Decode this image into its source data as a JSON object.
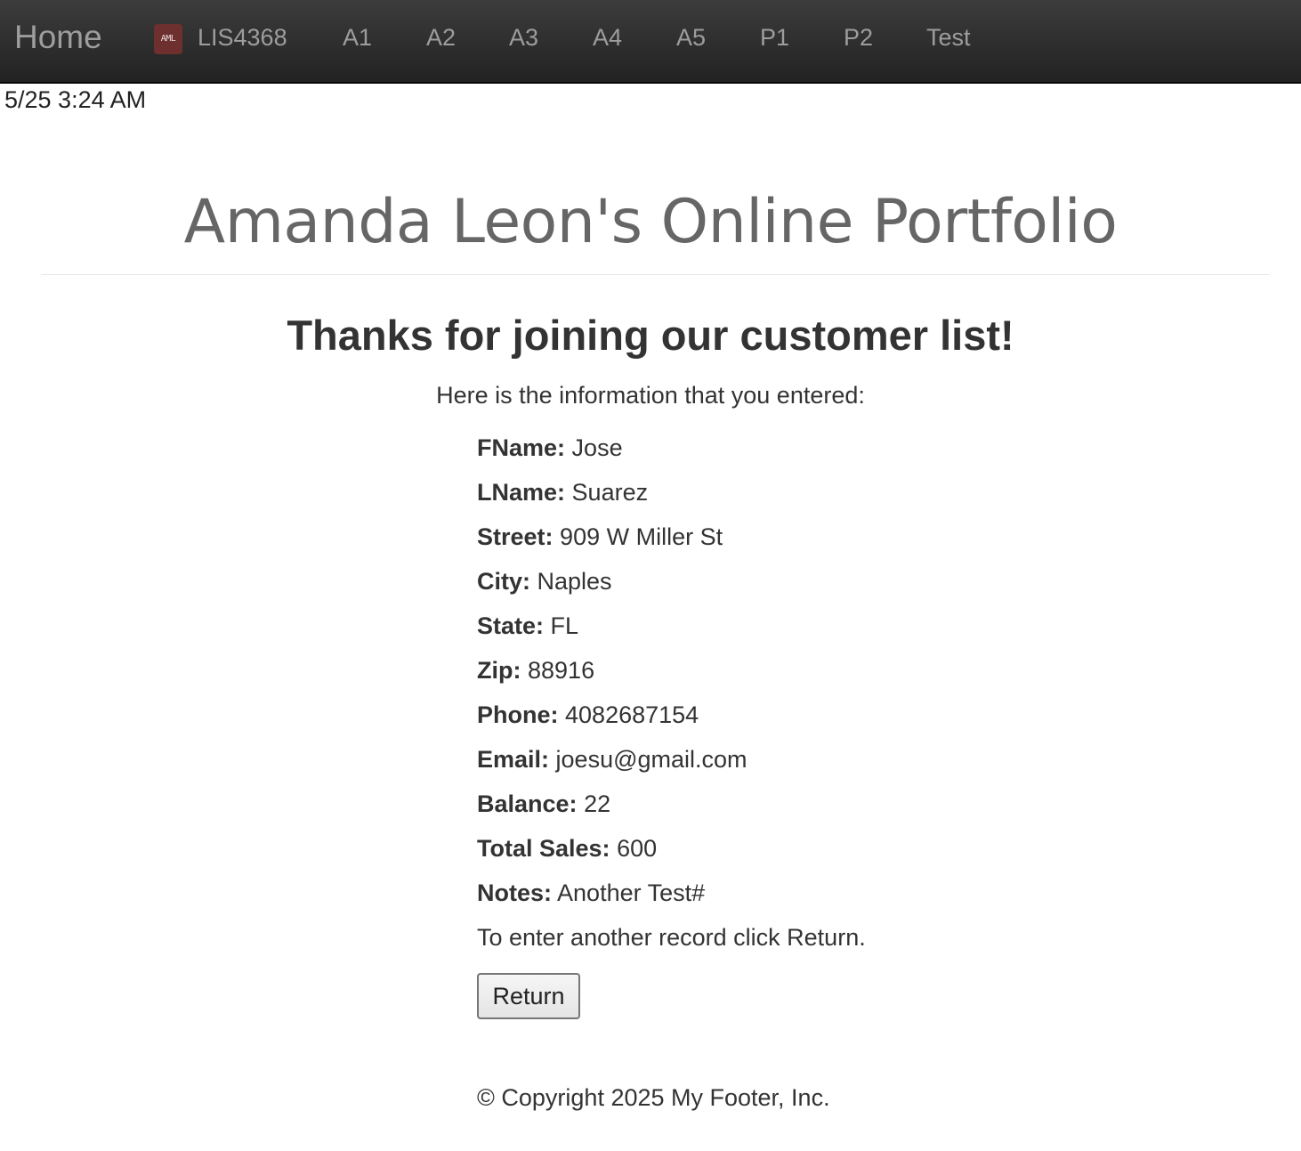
{
  "nav": {
    "brand": "Home",
    "logo_text": "AML",
    "links": [
      "LIS4368",
      "A1",
      "A2",
      "A3",
      "A4",
      "A5",
      "P1",
      "P2",
      "Test"
    ]
  },
  "timestamp": "5/25 3:24 AM",
  "portfolio_title": "Amanda Leon's Online Portfolio",
  "heading": "Thanks for joining our customer list!",
  "intro": "Here is the information that you entered:",
  "fields": [
    {
      "label": "FName:",
      "value": "Jose"
    },
    {
      "label": "LName:",
      "value": "Suarez"
    },
    {
      "label": "Street:",
      "value": "909 W Miller St"
    },
    {
      "label": "City:",
      "value": "Naples"
    },
    {
      "label": "State:",
      "value": "FL"
    },
    {
      "label": "Zip:",
      "value": "88916"
    },
    {
      "label": "Phone:",
      "value": "4082687154"
    },
    {
      "label": "Email:",
      "value": "joesu@gmail.com"
    },
    {
      "label": "Balance:",
      "value": "22"
    },
    {
      "label": "Total Sales:",
      "value": "600"
    },
    {
      "label": "Notes:",
      "value": "Another Test#"
    }
  ],
  "return_instruction": "To enter another record click Return.",
  "return_button": "Return",
  "footer": "© Copyright 2025 My Footer, Inc.",
  "colors": {
    "navbar_top": "#3c3c3c",
    "navbar_bottom": "#222222",
    "nav_text": "#9d9d9d",
    "logo_bg": "#6e2f2f",
    "title_text": "#666666",
    "body_text": "#333333"
  }
}
